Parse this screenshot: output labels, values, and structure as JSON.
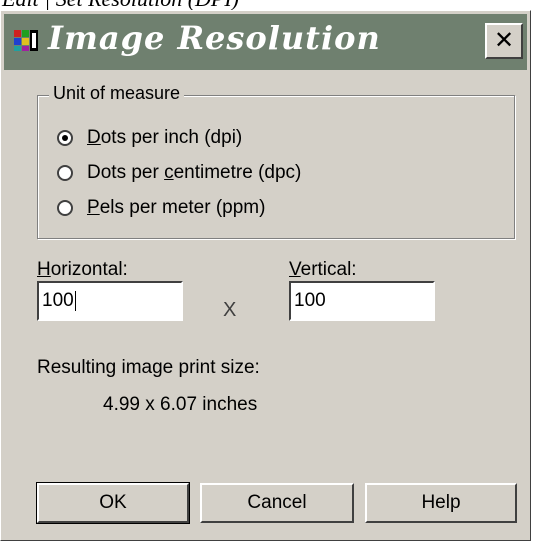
{
  "caption": "Edit | Set Resolution (DPI)",
  "dialog": {
    "title": "Image Resolution",
    "close_symbol": "✕",
    "app_icon": "image-resolution-icon"
  },
  "unit_group": {
    "legend": "Unit of measure",
    "options": [
      {
        "accel": "D",
        "rest": "ots per inch (dpi)",
        "selected": true
      },
      {
        "pre": "Dots per ",
        "accel": "c",
        "rest": "entimetre (dpc)",
        "selected": false
      },
      {
        "accel": "P",
        "rest": "els per meter (ppm)",
        "selected": false
      }
    ]
  },
  "fields": {
    "horizontal_accel": "H",
    "horizontal_rest": "orizontal:",
    "horizontal_value": "100",
    "times_symbol": "X",
    "vertical_accel": "V",
    "vertical_rest": "ertical:",
    "vertical_value": "100"
  },
  "result": {
    "label": "Resulting image print size:",
    "value": "4.99 x 6.07 inches"
  },
  "buttons": {
    "ok": "OK",
    "cancel": "Cancel",
    "help": "Help"
  }
}
